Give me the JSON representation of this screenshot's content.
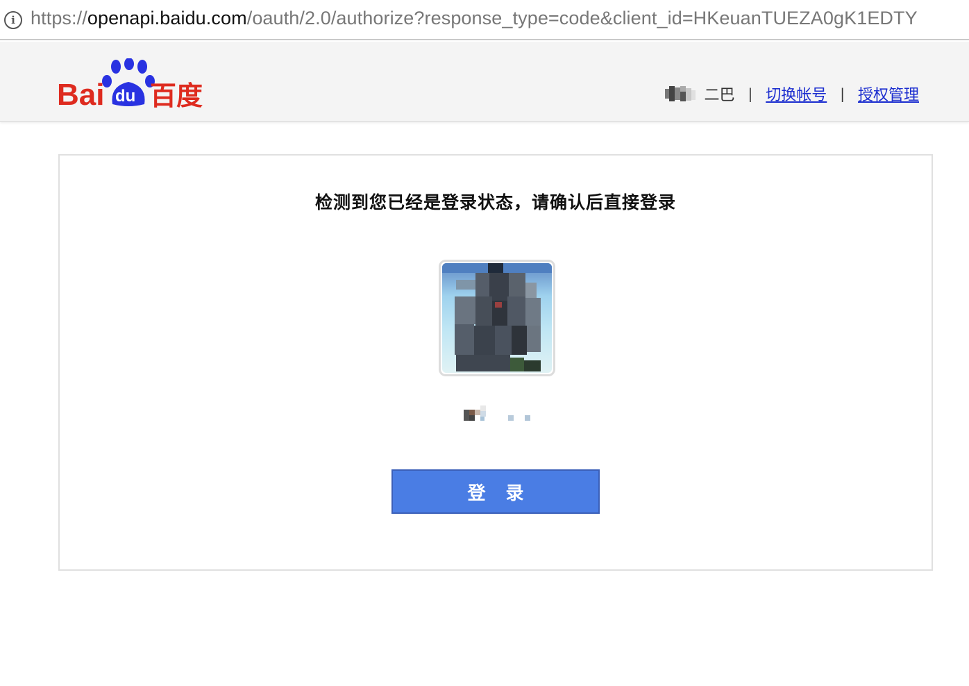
{
  "address_bar": {
    "scheme": "https://",
    "host": "openapi.baidu.com",
    "path": "/oauth/2.0/authorize?response_type=code&client_id=HKeuanTUEZA0gK1EDTY"
  },
  "header": {
    "logo_text": "Bai du 百度",
    "user_name_suffix": "二巴",
    "separator": "|",
    "switch_account": "切换帐号",
    "auth_manage": "授权管理"
  },
  "card": {
    "title": "检测到您已经是登录状态，请确认后直接登录",
    "login_button": "登 录"
  },
  "colors": {
    "brand_red": "#de2b1f",
    "brand_blue": "#2932e1",
    "button_blue": "#4a7de4",
    "link_blue": "#1a2ccf"
  }
}
